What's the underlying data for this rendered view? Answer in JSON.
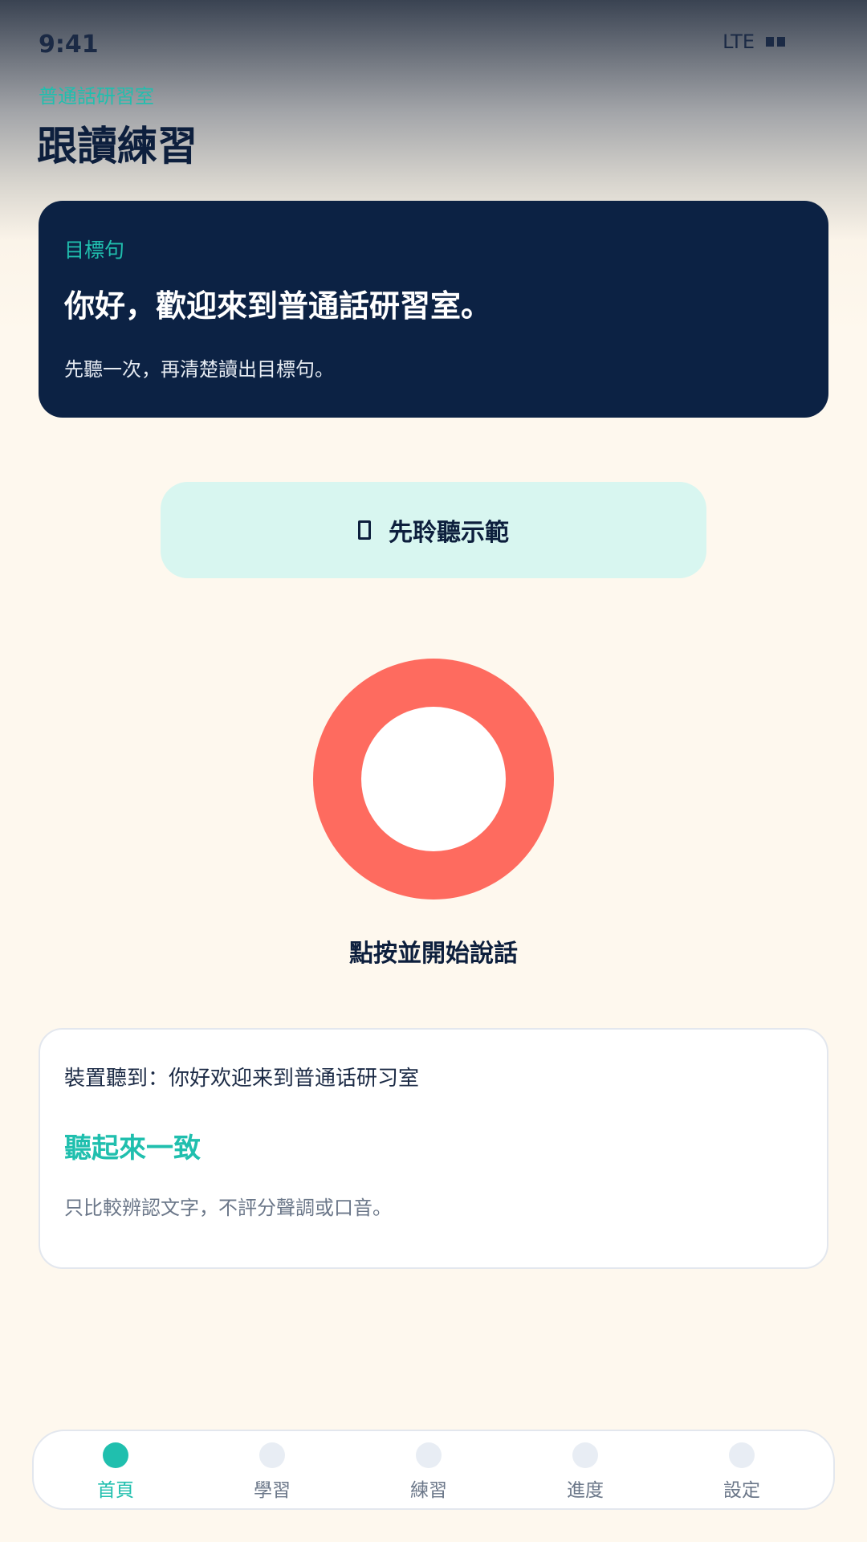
{
  "status_bar": {
    "time": "9:41",
    "network": "LTE",
    "battery_icon": "battery-icon"
  },
  "header": {
    "brand": "普通話研習室",
    "title": "跟讀練習"
  },
  "target_card": {
    "label": "目標句",
    "sentence": "你好，歡迎來到普通話研習室。",
    "hint": "先聽一次，再清楚讀出目標句。"
  },
  "listen_button": {
    "icon": "speaker-icon",
    "label": "先聆聽示範"
  },
  "record": {
    "label": "點按並開始說話",
    "color": "#fe6b5f"
  },
  "result": {
    "heard": "裝置聽到：你好欢迎来到普通话研习室",
    "match": "聽起來一致",
    "disclaimer": "只比較辨認文字，不評分聲調或口音。"
  },
  "nav": {
    "items": [
      {
        "label": "首頁",
        "active": true
      },
      {
        "label": "學習",
        "active": false
      },
      {
        "label": "練習",
        "active": false
      },
      {
        "label": "進度",
        "active": false
      },
      {
        "label": "設定",
        "active": false
      }
    ]
  },
  "colors": {
    "accent": "#20bfae",
    "navy": "#0c2244",
    "record": "#fe6b5f"
  }
}
